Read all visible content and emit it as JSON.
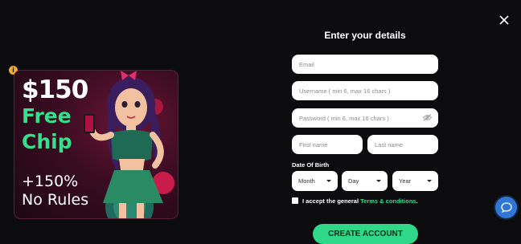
{
  "promo": {
    "amount": "$150",
    "line1": "Free",
    "line2": "Chip",
    "bonus": "+150%",
    "rules": "No Rules"
  },
  "form": {
    "title": "Enter your details",
    "email_placeholder": "Email",
    "username_placeholder": "Username ( min 6, max 16 chars )",
    "password_placeholder": "Password ( min 6, max 16 chars )",
    "first_name_placeholder": "First name",
    "last_name_placeholder": "Last name",
    "dob_label": "Date Of Birth",
    "month": "Month",
    "day": "Day",
    "year": "Year",
    "accept_text": "I accept the general",
    "terms_link": "Terms & conditions",
    "accept_suffix": ".",
    "submit": "CREATE ACCOUNT"
  },
  "colors": {
    "background": "#0c0c0e",
    "accent": "#2fd888",
    "chat": "#2f76d6"
  },
  "icons": {
    "close": "close-icon",
    "info": "info-icon",
    "eye": "eye-off-icon",
    "chat": "chat-bubble-icon"
  }
}
